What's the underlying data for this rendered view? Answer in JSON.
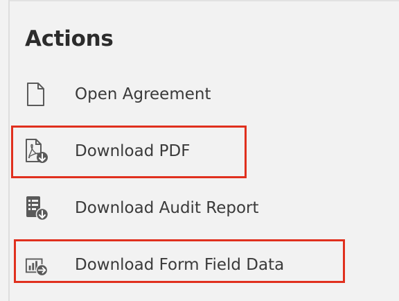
{
  "panel": {
    "title": "Actions"
  },
  "actions": [
    {
      "label": "Open Agreement",
      "icon": "document-icon"
    },
    {
      "label": "Download PDF",
      "icon": "pdf-download-icon"
    },
    {
      "label": "Download Audit Report",
      "icon": "audit-report-download-icon"
    },
    {
      "label": "Download Form Field Data",
      "icon": "form-data-download-icon"
    }
  ],
  "colors": {
    "highlight": "#e0301e",
    "text": "#3a3a3a",
    "icon": "#5a5a5a",
    "background": "#f2f2f2"
  }
}
